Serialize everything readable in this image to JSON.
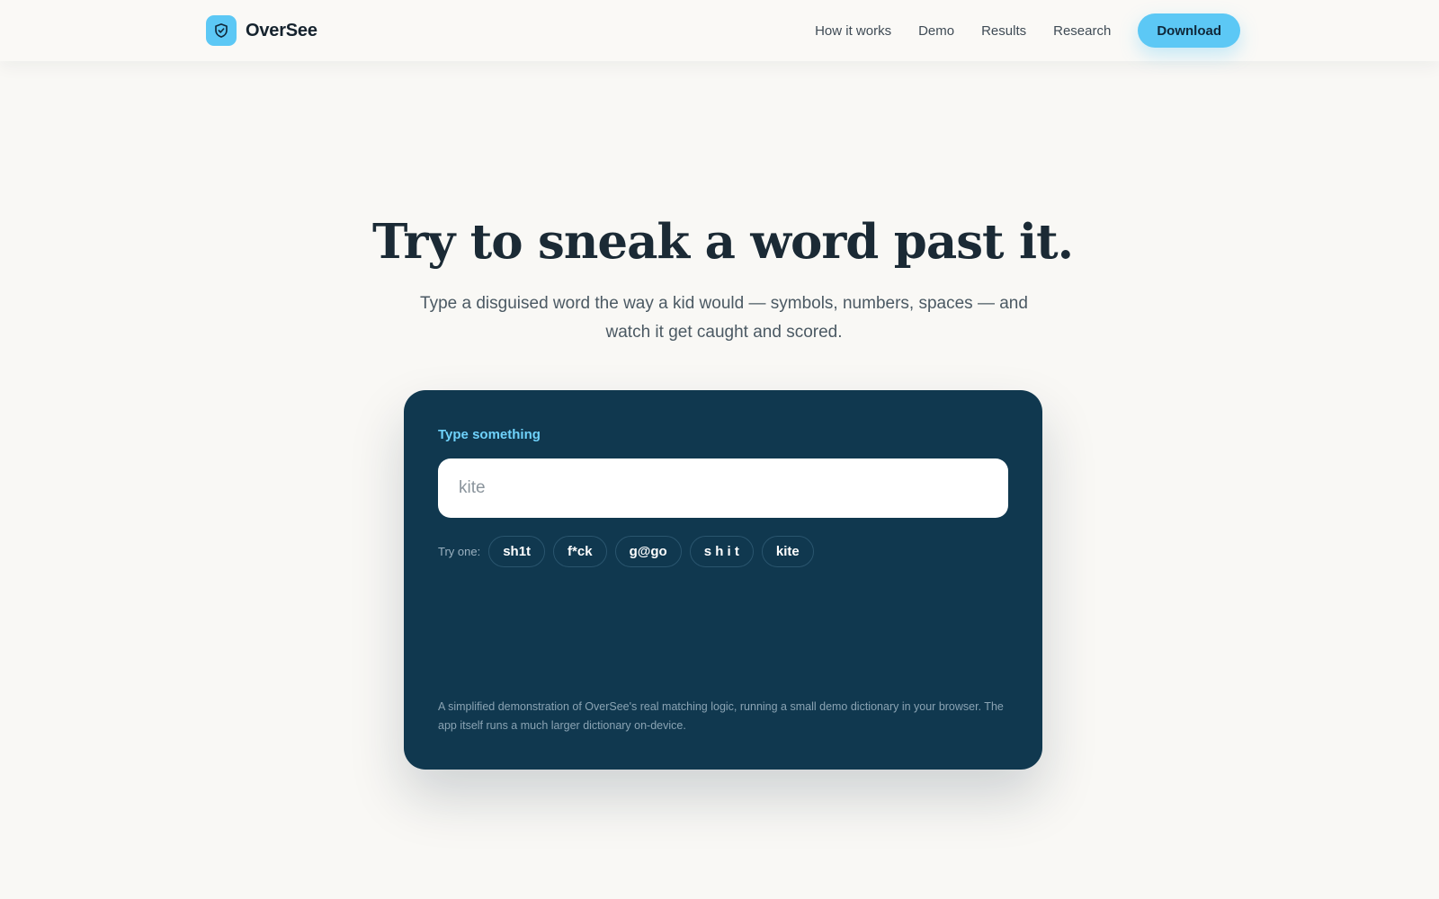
{
  "brand": {
    "name": "OverSee",
    "icon": "shield-check-icon",
    "color": "#5cc8f5"
  },
  "nav": {
    "links": [
      "How it works",
      "Demo",
      "Results",
      "Research"
    ],
    "download_label": "Download"
  },
  "hero": {
    "title": "Try to sneak a word past it.",
    "subtitle": "Type a disguised word the way a kid would — symbols, numbers, spaces — and watch it get caught and scored."
  },
  "demo": {
    "label": "Type something",
    "input_placeholder": "kite",
    "input_value": "",
    "try_label": "Try one:",
    "chips": [
      "sh1t",
      "f*ck",
      "g@go",
      "s h i t",
      "kite"
    ],
    "note": "A simplified demonstration of OverSee's real matching logic, running a small demo dictionary in your browser. The app itself runs a much larger dictionary on-device.",
    "card_color": "#10384f",
    "accent_color": "#6fd2fb"
  }
}
